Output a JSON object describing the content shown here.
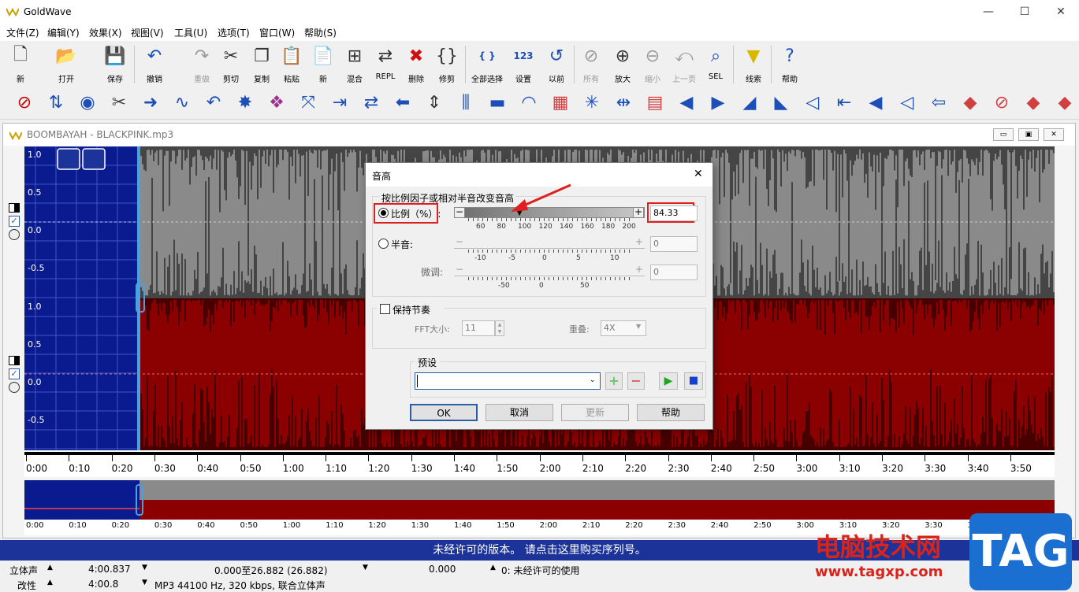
{
  "window": {
    "title": "GoldWave",
    "min": "—",
    "max": "☐",
    "close": "✕"
  },
  "menu": [
    "文件(Z)",
    "编辑(Y)",
    "效果(X)",
    "视图(V)",
    "工具(U)",
    "选项(T)",
    "窗口(W)",
    "帮助(S)"
  ],
  "toolbar": [
    {
      "label": "新",
      "icon": "new-file-icon",
      "glyph": "🗋"
    },
    {
      "label": "打开",
      "icon": "open-icon",
      "glyph": "📂"
    },
    {
      "label": "保存",
      "icon": "save-icon",
      "glyph": "💾"
    },
    {
      "label": "撤销",
      "icon": "undo-icon",
      "glyph": "↶"
    },
    {
      "label": "重做",
      "icon": "redo-icon",
      "glyph": "↷",
      "disabled": true
    },
    {
      "label": "剪切",
      "icon": "cut-icon",
      "glyph": "✂"
    },
    {
      "label": "复制",
      "icon": "copy-icon",
      "glyph": "❐"
    },
    {
      "label": "粘贴",
      "icon": "paste-icon",
      "glyph": "📋"
    },
    {
      "label": "新",
      "icon": "paste-new-icon",
      "glyph": "📄"
    },
    {
      "label": "混合",
      "icon": "mix-icon",
      "glyph": "⊞"
    },
    {
      "label": "REPL",
      "icon": "replace-icon",
      "glyph": "⇄"
    },
    {
      "label": "删除",
      "icon": "delete-icon",
      "glyph": "✖"
    },
    {
      "label": "修剪",
      "icon": "trim-icon",
      "glyph": "{}"
    },
    {
      "label": "全部选择",
      "icon": "select-all-icon",
      "glyph": "{ }"
    },
    {
      "label": "设置",
      "icon": "set-icon",
      "glyph": "123"
    },
    {
      "label": "以前",
      "icon": "previous-icon",
      "glyph": "↺"
    },
    {
      "label": "所有",
      "icon": "zoom-all-icon",
      "glyph": "⊘",
      "disabled": true
    },
    {
      "label": "放大",
      "icon": "zoom-in-icon",
      "glyph": "⊕"
    },
    {
      "label": "缩小",
      "icon": "zoom-out-icon",
      "glyph": "⊖",
      "disabled": true
    },
    {
      "label": "上一页",
      "icon": "previous-page-icon",
      "glyph": "⤺",
      "disabled": true
    },
    {
      "label": "SEL",
      "icon": "zoom-selection-icon",
      "glyph": "⌕"
    },
    {
      "label": "线索",
      "icon": "cue-icon",
      "glyph": "▼"
    },
    {
      "label": "帮助",
      "icon": "help-icon",
      "glyph": "?"
    }
  ],
  "doc": {
    "title": "BOOMBAYAH - BLACKPINK.mp3"
  },
  "amplitude_labels": [
    "1.0",
    "0.5",
    "0.0",
    "-0.5"
  ],
  "timeline": [
    "0:00",
    "0:10",
    "0:20",
    "0:30",
    "0:40",
    "0:50",
    "1:00",
    "1:10",
    "1:20",
    "1:30",
    "1:40",
    "1:50",
    "2:00",
    "2:10",
    "2:20",
    "2:30",
    "2:40",
    "2:50",
    "3:00",
    "3:10",
    "3:20",
    "3:30",
    "3:40",
    "3:50"
  ],
  "banner": "未经许可的版本。 请点击这里购买序列号。",
  "status": {
    "r1": [
      "立体声",
      "4:00.837",
      "0.000至26.882 (26.882)",
      "0.000",
      "0:  未经许可的使用"
    ],
    "r2": [
      "改性",
      "4:00.8",
      "MP3 44100 Hz, 320 kbps, 联合立体声"
    ]
  },
  "dialog": {
    "title": "音高",
    "close": "✕",
    "group1": "按比例因子或相对半音改变音高",
    "ratio_label": "比例（%）:",
    "ratio_value": "84.33",
    "ratio_ticks": [
      "60",
      "80",
      "100",
      "120",
      "140",
      "160",
      "180",
      "200"
    ],
    "semitone_label": "半音:",
    "semitone_value": "0",
    "semitone_ticks": [
      "-10",
      "-5",
      "0",
      "5",
      "10"
    ],
    "fine_label": "微调:",
    "fine_value": "0",
    "fine_ticks": [
      "-50",
      "0",
      "50"
    ],
    "keep_tempo": "保持节奏",
    "fft_label": "FFT大小:",
    "fft_value": "11",
    "overlap_label": "重叠:",
    "overlap_value": "4X",
    "preset_label": "预设",
    "preset_value": "",
    "ok": "OK",
    "cancel": "取消",
    "update": "更新",
    "help": "帮助"
  },
  "watermark": {
    "text": "电脑技术网",
    "url": "www.tagxp.com",
    "tag": "TAG"
  },
  "colors": {
    "selection": "#0a1b8f",
    "top_channel": "#8a8a8a",
    "bottom_channel": "#8b0000",
    "highlight": "#e02020"
  }
}
